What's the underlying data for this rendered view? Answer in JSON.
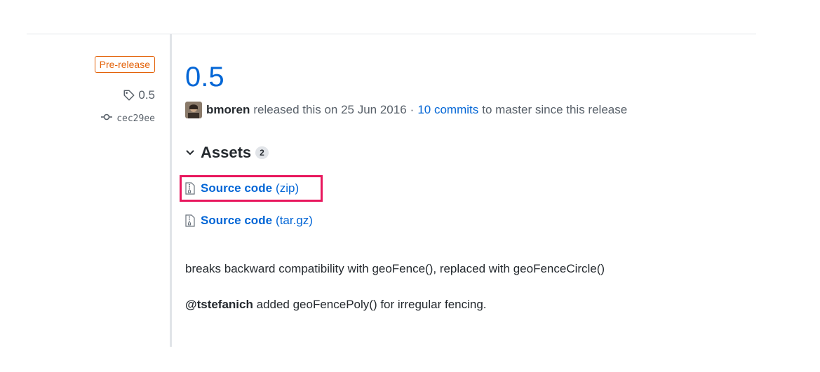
{
  "meta": {
    "prerelease_label": "Pre-release",
    "tag": "0.5",
    "commit": "cec29ee"
  },
  "release": {
    "title": "0.5",
    "author": "bmoren",
    "released_text": "released this on 25 Jun 2016",
    "separator": "·",
    "commits_link": "10 commits",
    "since_text": "to master since this release"
  },
  "assets": {
    "title": "Assets",
    "count": "2",
    "items": [
      {
        "name": "Source code",
        "ext": "(zip)"
      },
      {
        "name": "Source code",
        "ext": "(tar.gz)"
      }
    ]
  },
  "notes": {
    "line1": "breaks backward compatibility with geoFence(), replaced with geoFenceCircle()",
    "mention": "@tstefanich",
    "line2_rest": "added geoFencePoly() for irregular fencing."
  },
  "colors": {
    "link": "#0366d6",
    "prerelease": "#e36209",
    "highlight": "#e8175d"
  },
  "icons": [
    "tag-icon",
    "git-commit-icon",
    "chevron-down-icon",
    "file-zip-icon"
  ]
}
